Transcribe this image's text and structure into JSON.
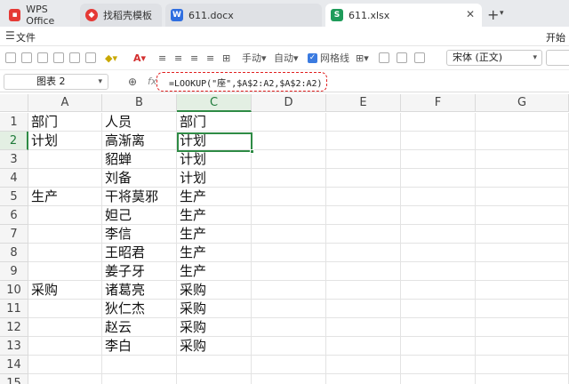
{
  "tabs": [
    {
      "label": "WPS Office",
      "icon": "wps-logo-icon",
      "color": "#e53935"
    },
    {
      "label": "找稻壳模板",
      "icon": "docer-icon",
      "color": "#e53935"
    },
    {
      "label": "611.docx",
      "icon": "word-doc-icon",
      "color": "#2f6ee0"
    },
    {
      "label": "611.xlsx",
      "icon": "spreadsheet-icon",
      "color": "#1e9b5a"
    }
  ],
  "tab_icon_letters": {
    "word": "W",
    "sheet": "S"
  },
  "menu": {
    "file": "文件",
    "start": "开始"
  },
  "toolbar": {
    "manual": "手动",
    "auto": "自动",
    "gridlines": "网格线",
    "font": "宋体 (正文)"
  },
  "formula_bar": {
    "name_box": "图表 2",
    "fx": "fx",
    "formula": "=LOOKUP(\"座\",$A$2:A2,$A$2:A2)"
  },
  "columns": [
    "A",
    "B",
    "C",
    "D",
    "E",
    "F",
    "G"
  ],
  "selected_column": "C",
  "selected_row": "2",
  "rows": [
    {
      "n": "1",
      "A": "部门",
      "B": "人员",
      "C": "部门"
    },
    {
      "n": "2",
      "A": "计划",
      "B": "高渐离",
      "C": "计划"
    },
    {
      "n": "3",
      "A": "",
      "B": "貂蝉",
      "C": "计划"
    },
    {
      "n": "4",
      "A": "",
      "B": "刘备",
      "C": "计划"
    },
    {
      "n": "5",
      "A": "生产",
      "B": "干将莫邪",
      "C": "生产"
    },
    {
      "n": "6",
      "A": "",
      "B": "妲己",
      "C": "生产"
    },
    {
      "n": "7",
      "A": "",
      "B": "李信",
      "C": "生产"
    },
    {
      "n": "8",
      "A": "",
      "B": "王昭君",
      "C": "生产"
    },
    {
      "n": "9",
      "A": "",
      "B": "姜子牙",
      "C": "生产"
    },
    {
      "n": "10",
      "A": "采购",
      "B": "诸葛亮",
      "C": "采购"
    },
    {
      "n": "11",
      "A": "",
      "B": "狄仁杰",
      "C": "采购"
    },
    {
      "n": "12",
      "A": "",
      "B": "赵云",
      "C": "采购"
    },
    {
      "n": "13",
      "A": "",
      "B": "李白",
      "C": "采购"
    },
    {
      "n": "14",
      "A": "",
      "B": "",
      "C": ""
    },
    {
      "n": "15",
      "A": "",
      "B": "",
      "C": ""
    }
  ],
  "colors": {
    "accent_green": "#2e8b45",
    "highlight_red": "#e02020"
  }
}
